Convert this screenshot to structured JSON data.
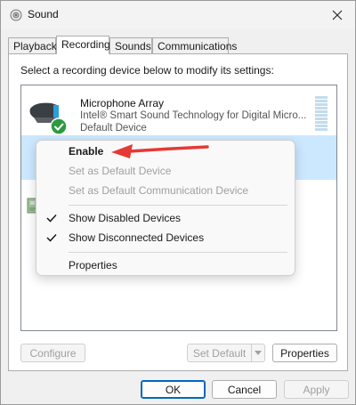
{
  "window": {
    "title": "Sound"
  },
  "tabs": [
    {
      "label": "Playback"
    },
    {
      "label": "Recording"
    },
    {
      "label": "Sounds"
    },
    {
      "label": "Communications"
    }
  ],
  "active_tab": "Recording",
  "instruction": "Select a recording device below to modify its settings:",
  "devices": [
    {
      "name": "Microphone Array",
      "description": "Intel® Smart Sound Technology for Digital Micro...",
      "status": "Default Device",
      "icon": "microphone-array-icon",
      "badge": "green-check"
    }
  ],
  "context_menu": {
    "items": [
      {
        "label": "Enable",
        "enabled": true,
        "bold": true,
        "checked": false
      },
      {
        "label": "Set as Default Device",
        "enabled": false,
        "checked": false
      },
      {
        "label": "Set as Default Communication Device",
        "enabled": false,
        "checked": false
      },
      {
        "label": "Show Disabled Devices",
        "enabled": true,
        "checked": true
      },
      {
        "label": "Show Disconnected Devices",
        "enabled": true,
        "checked": true
      },
      {
        "label": "Properties",
        "enabled": true,
        "checked": false
      }
    ]
  },
  "buttons": {
    "configure": "Configure",
    "set_default": "Set Default",
    "properties": "Properties",
    "ok": "OK",
    "cancel": "Cancel",
    "apply": "Apply"
  },
  "colors": {
    "selection": "#cce8ff",
    "annotation_arrow": "#e53935",
    "default_button_border": "#0067c0",
    "check_badge": "#2e9a3e"
  }
}
